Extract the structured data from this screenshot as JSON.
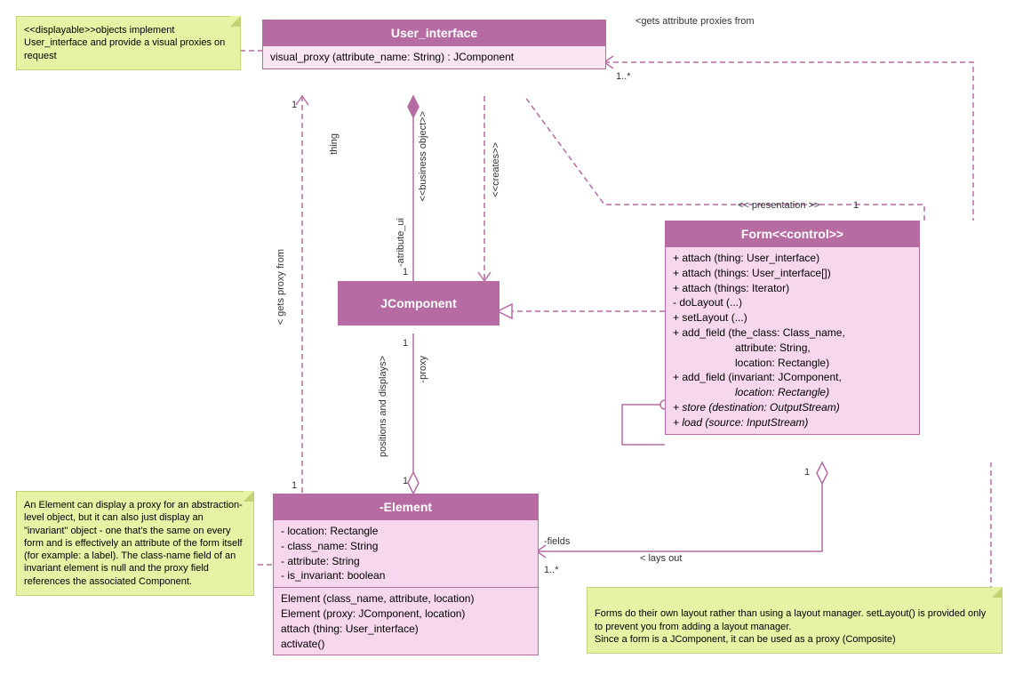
{
  "notes": {
    "displayable": "<<displayable>>objects implement User_interface and provide a visual proxies on request",
    "element": "An Element can display a proxy for an abstraction-level object, but it can also just display an \"invariant\" object - one that's the same on every form and is effectively an attribute of the form itself (for example: a label). The class-name field of an invariant element is null and the proxy field references the associated Component.",
    "form": "Forms do their own layout rather than using a layout manager. setLayout() is provided only to prevent you from adding a layout manager.\nSince a form is a JComponent, it can be used as a proxy (Composite)"
  },
  "classes": {
    "user_interface": {
      "name": "User_interface",
      "op1": "visual_proxy (attribute_name: String) : JComponent"
    },
    "jcomponent": {
      "name": "JComponent"
    },
    "element": {
      "name": "-Element",
      "a1": "- location: Rectangle",
      "a2": "- class_name: String",
      "a3": "- attribute: String",
      "a4": "- is_invariant: boolean",
      "o1": "Element (class_name, attribute, location)",
      "o2": "Element (proxy: JComponent, location)",
      "o3": "attach (thing: User_interface)",
      "o4": "activate()"
    },
    "form": {
      "name": "Form<<control>>",
      "o1": "+ attach (thing: User_interface)",
      "o2": "+ attach (things: User_interface[])",
      "o3": "+ attach (things: Iterator)",
      "o4": "- doLayout (...)",
      "o5": "+ setLayout (...)",
      "o6a": "+ add_field (the_class: Class_name,",
      "o6b": "                     attribute: String,",
      "o6c": "                     location: Rectangle)",
      "o7a": "+ add_field (invariant: JComponent,",
      "o7b": "                     location: Rectangle)",
      "o8": "+ store (destination: OutputStream)",
      "o9": "+ load (source: InputStream)"
    }
  },
  "labels": {
    "gets_attr_proxies": "<gets attribute proxies from",
    "presentation": "<< presentation >>",
    "one": "1",
    "one_star": "1..*",
    "thing": "thing",
    "bo": "<<business object>>",
    "creates": "<<creates>>",
    "atribute_ui": "-atribute_ui",
    "gets_proxy": "< gets proxy from",
    "positions": "positions and displays>",
    "proxy": "-proxy",
    "fields": "-fields",
    "lays_out": "< lays out"
  }
}
